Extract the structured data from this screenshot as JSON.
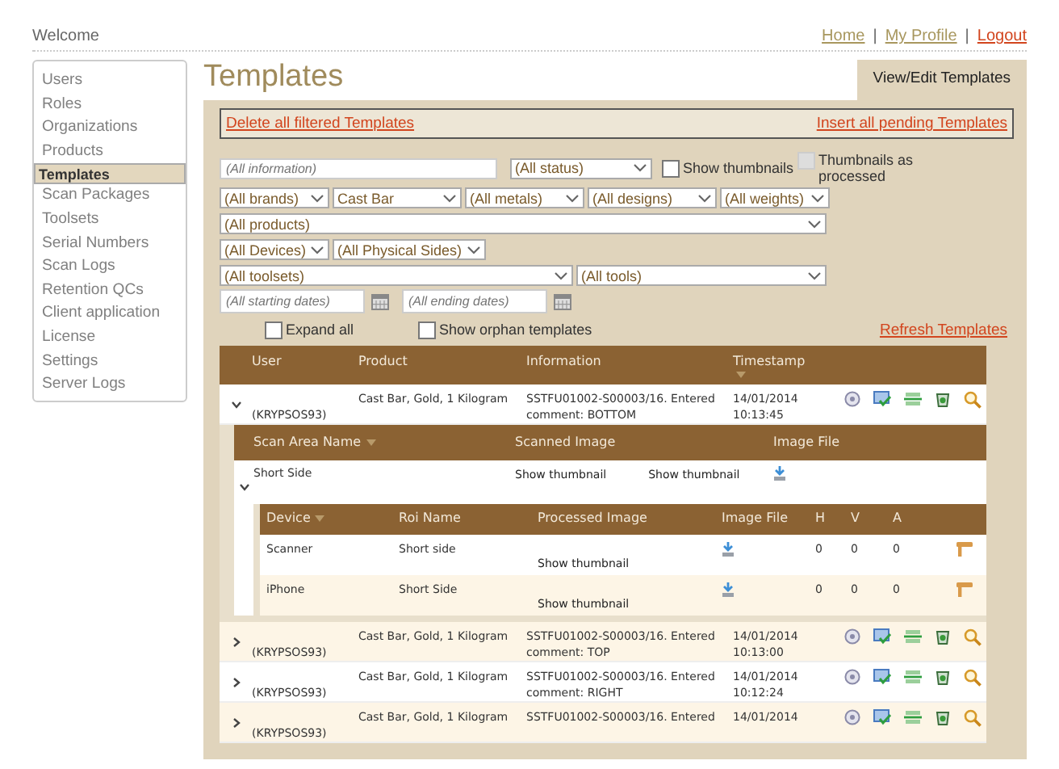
{
  "header": {
    "welcome": "Welcome",
    "links": [
      {
        "label": "Home",
        "kind": "nav"
      },
      {
        "label": "My Profile",
        "kind": "nav"
      },
      {
        "label": "Logout",
        "kind": "logout"
      }
    ],
    "separators": [
      "|",
      "|"
    ]
  },
  "sidebar": {
    "items": [
      {
        "label": "Users",
        "selected": false
      },
      {
        "label": "Roles",
        "selected": false
      },
      {
        "label": "Organizations",
        "selected": false
      },
      {
        "label": "Products",
        "selected": false
      },
      {
        "label": "Templates",
        "selected": true
      },
      {
        "label": "Scan Packages",
        "selected": false
      },
      {
        "label": "Toolsets",
        "selected": false
      },
      {
        "label": "Serial Numbers",
        "selected": false
      },
      {
        "label": "Scan Logs",
        "selected": false
      },
      {
        "label": "Retention QCs",
        "selected": false
      },
      {
        "label": "Client application",
        "selected": false
      },
      {
        "label": "License",
        "selected": false
      },
      {
        "label": "Settings",
        "selected": false
      },
      {
        "label": "Server Logs",
        "selected": false
      }
    ]
  },
  "title": "Templates",
  "tabs": [
    {
      "label": "View/Edit Templates",
      "selected": true
    }
  ],
  "actions": {
    "delete": "Delete all filtered Templates",
    "insert": "Insert all pending Templates"
  },
  "filter_rows": [
    [
      {
        "kind": "input",
        "placeholder": "(All information)"
      },
      {
        "kind": "select",
        "value": "(All status)"
      },
      {
        "kind": "checkbox",
        "label": "Show thumbnails",
        "checked": false,
        "disabled": false
      },
      {
        "kind": "checkbox",
        "label": "Thumbnails as processed",
        "checked": false,
        "disabled": true
      }
    ],
    [
      {
        "kind": "select",
        "value": "(All brands)"
      },
      {
        "kind": "select",
        "value": "Cast Bar"
      },
      {
        "kind": "select",
        "value": "(All metals)"
      },
      {
        "kind": "select",
        "value": "(All designs)"
      },
      {
        "kind": "select",
        "value": "(All weights)"
      }
    ],
    [
      {
        "kind": "select",
        "value": "(All products)"
      }
    ],
    [
      {
        "kind": "select",
        "value": "(All Devices)"
      },
      {
        "kind": "select",
        "value": "(All Physical Sides)"
      }
    ],
    [
      {
        "kind": "select",
        "value": "(All toolsets)"
      },
      {
        "kind": "select",
        "value": "(All tools)"
      }
    ],
    [
      {
        "kind": "date",
        "placeholder": "(All starting dates)"
      },
      {
        "kind": "date",
        "placeholder": "(All ending dates)"
      }
    ]
  ],
  "options": {
    "expand_all": {
      "label": "Expand all",
      "checked": false
    },
    "show_orphans": {
      "label": "Show orphan templates",
      "checked": false
    },
    "refresh": "Refresh Templates"
  },
  "table": {
    "columns": [
      "User",
      "Product",
      "Information",
      "Timestamp"
    ],
    "rows": [
      {
        "user": "(KRYPSOS93)",
        "product": "Cast Bar, Gold, 1 Kilogram",
        "information": "SSTFU01002-S00003/16. Entered comment: BOTTOM",
        "timestamp": "14/01/2014 10:13:45",
        "expanded": true,
        "scan_areas": {
          "columns": [
            "Scan Area Name",
            "Scanned Image",
            "Image File"
          ],
          "rows": [
            {
              "name": "Short Side",
              "scanned": "Show thumbnail",
              "thumb": "Show thumbnail",
              "expanded": true,
              "rois": {
                "columns": [
                  "Device",
                  "Roi Name",
                  "Processed Image",
                  "Image File",
                  "H",
                  "V",
                  "A"
                ],
                "rows": [
                  {
                    "device": "Scanner",
                    "roi": "Short side",
                    "processed": "Show thumbnail",
                    "h": "0",
                    "v": "0",
                    "a": "0"
                  },
                  {
                    "device": "iPhone",
                    "roi": "Short Side",
                    "processed": "Show thumbnail",
                    "h": "0",
                    "v": "0",
                    "a": "0"
                  }
                ]
              }
            }
          ]
        }
      },
      {
        "user": "(KRYPSOS93)",
        "product": "Cast Bar, Gold, 1 Kilogram",
        "information": "SSTFU01002-S00003/16. Entered comment: TOP",
        "timestamp": "14/01/2014 10:13:00",
        "expanded": false
      },
      {
        "user": "(KRYPSOS93)",
        "product": "Cast Bar, Gold, 1 Kilogram",
        "information": "SSTFU01002-S00003/16. Entered comment: RIGHT",
        "timestamp": "14/01/2014 10:12:24",
        "expanded": false
      },
      {
        "user": "(KRYPSOS93)",
        "product": "Cast Bar, Gold, 1 Kilogram",
        "information": "SSTFU01002-S00003/16. Entered",
        "timestamp": "14/01/2014",
        "expanded": false
      }
    ]
  }
}
